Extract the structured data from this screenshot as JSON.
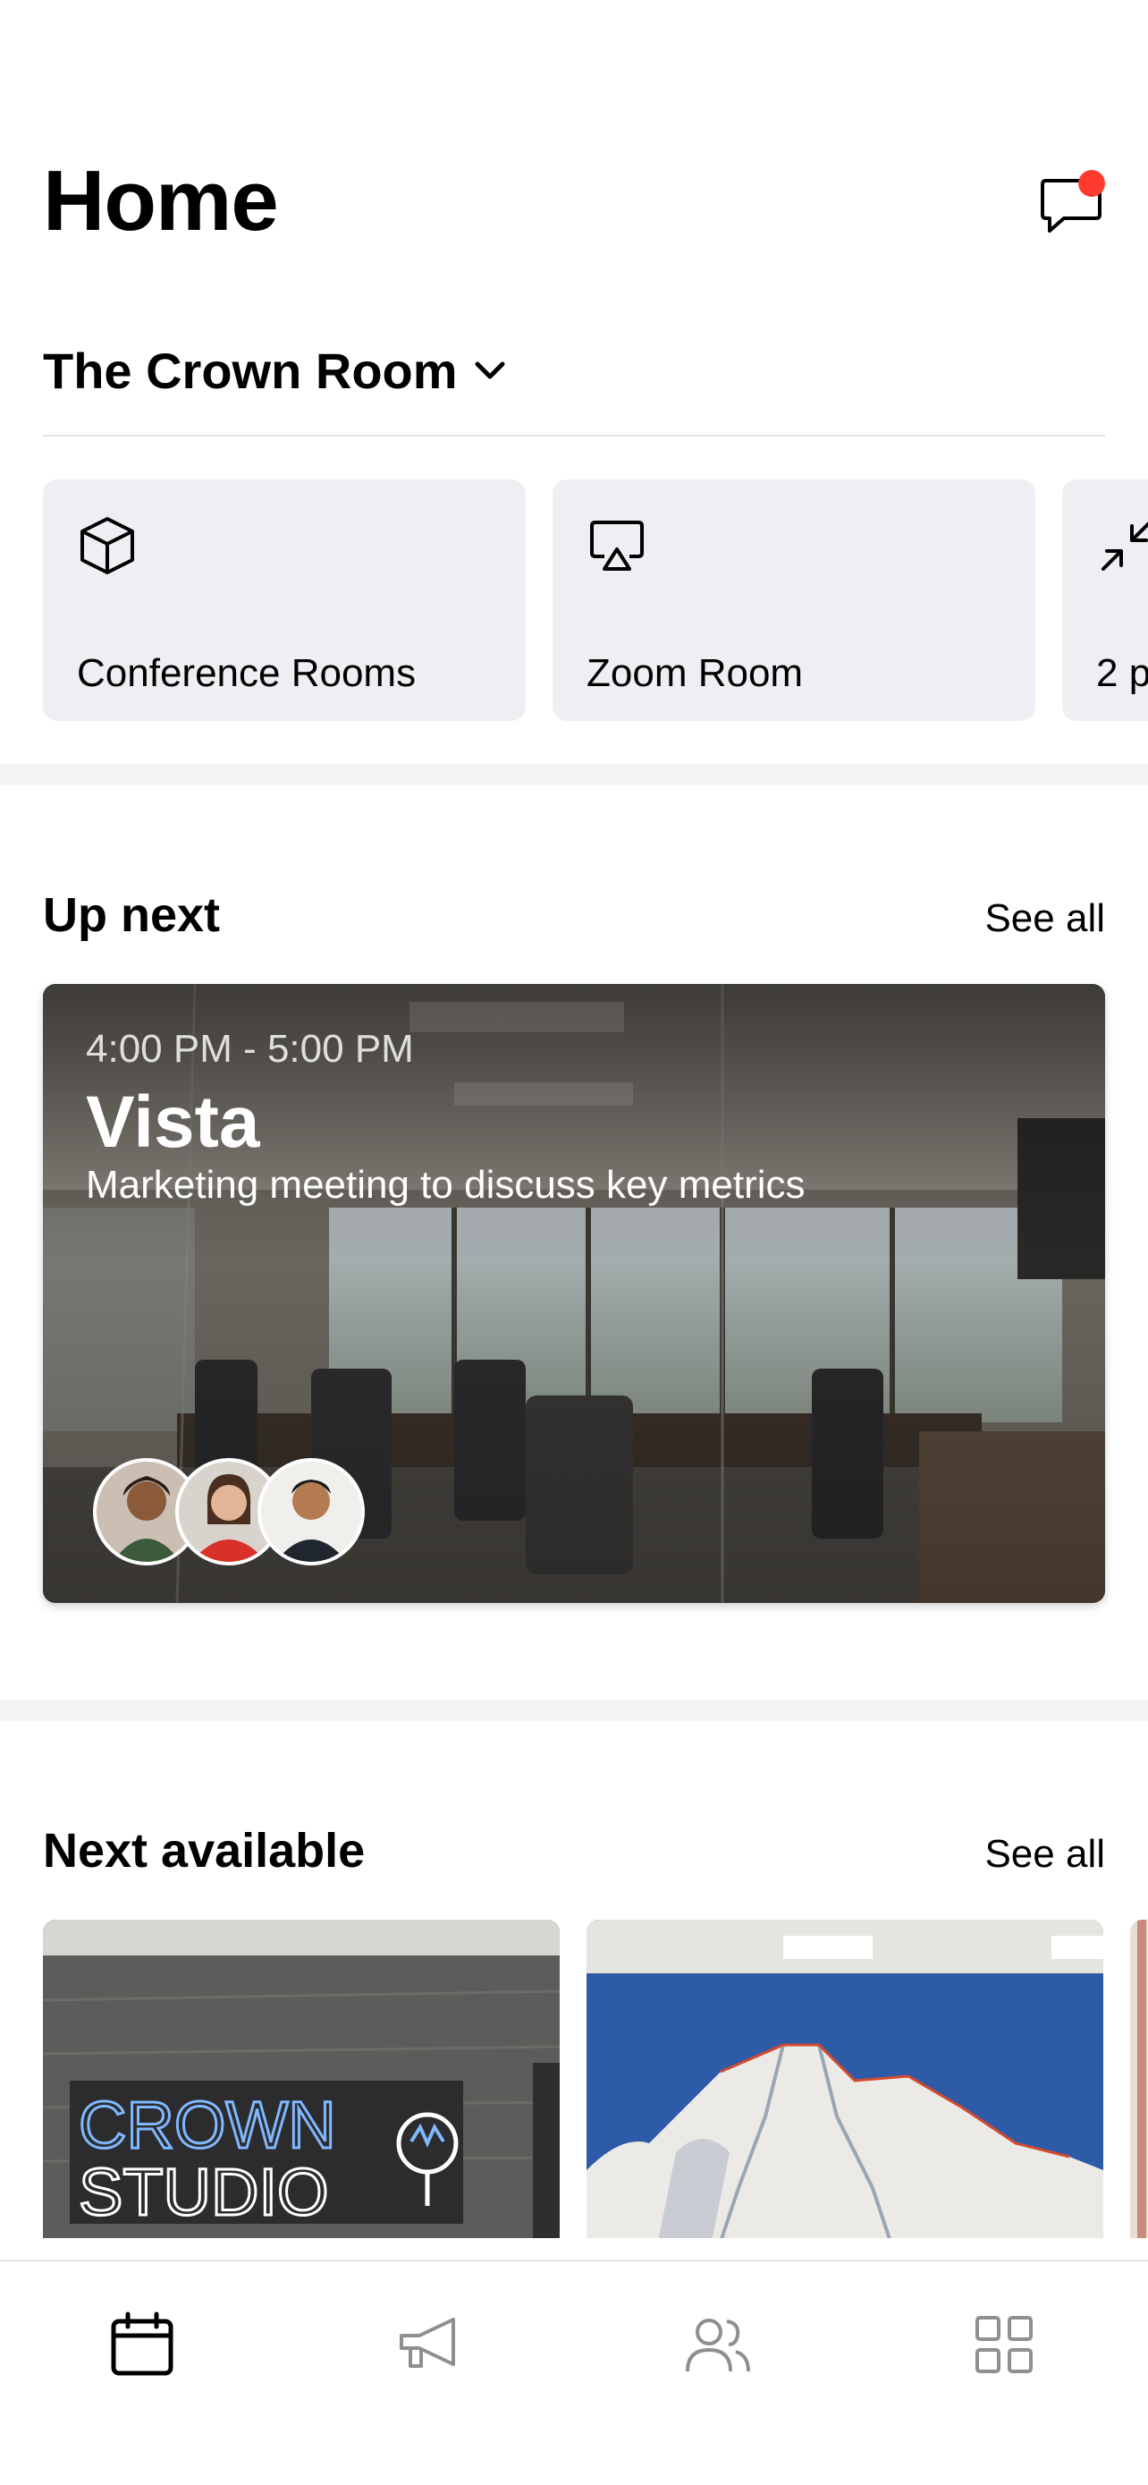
{
  "header": {
    "title": "Home",
    "has_unread_messages": true
  },
  "location": {
    "label": "The Crown Room"
  },
  "quick_actions": [
    {
      "label": "Conference Rooms",
      "icon": "cube-icon"
    },
    {
      "label": "Zoom Room",
      "icon": "airplay-icon"
    },
    {
      "label": "2 p",
      "icon": "collapse-arrows-icon"
    }
  ],
  "up_next": {
    "title": "Up next",
    "see_all": "See all",
    "event": {
      "time": "4:00 PM - 5:00 PM",
      "name": "Vista",
      "description": "Marketing meeting to discuss key metrics"
    }
  },
  "next_available": {
    "title": "Next available",
    "see_all": "See all",
    "room_sign": [
      "CROWN",
      "STUDIO"
    ]
  },
  "tabbar": {
    "tabs": [
      {
        "icon": "calendar-icon",
        "active": true
      },
      {
        "icon": "megaphone-icon",
        "active": false
      },
      {
        "icon": "people-icon",
        "active": false
      },
      {
        "icon": "grid-icon",
        "active": false
      }
    ]
  },
  "colors": {
    "accent_badge": "#ff3b30",
    "card_bg": "#efeff3",
    "inactive_icon": "#8e8e93"
  }
}
